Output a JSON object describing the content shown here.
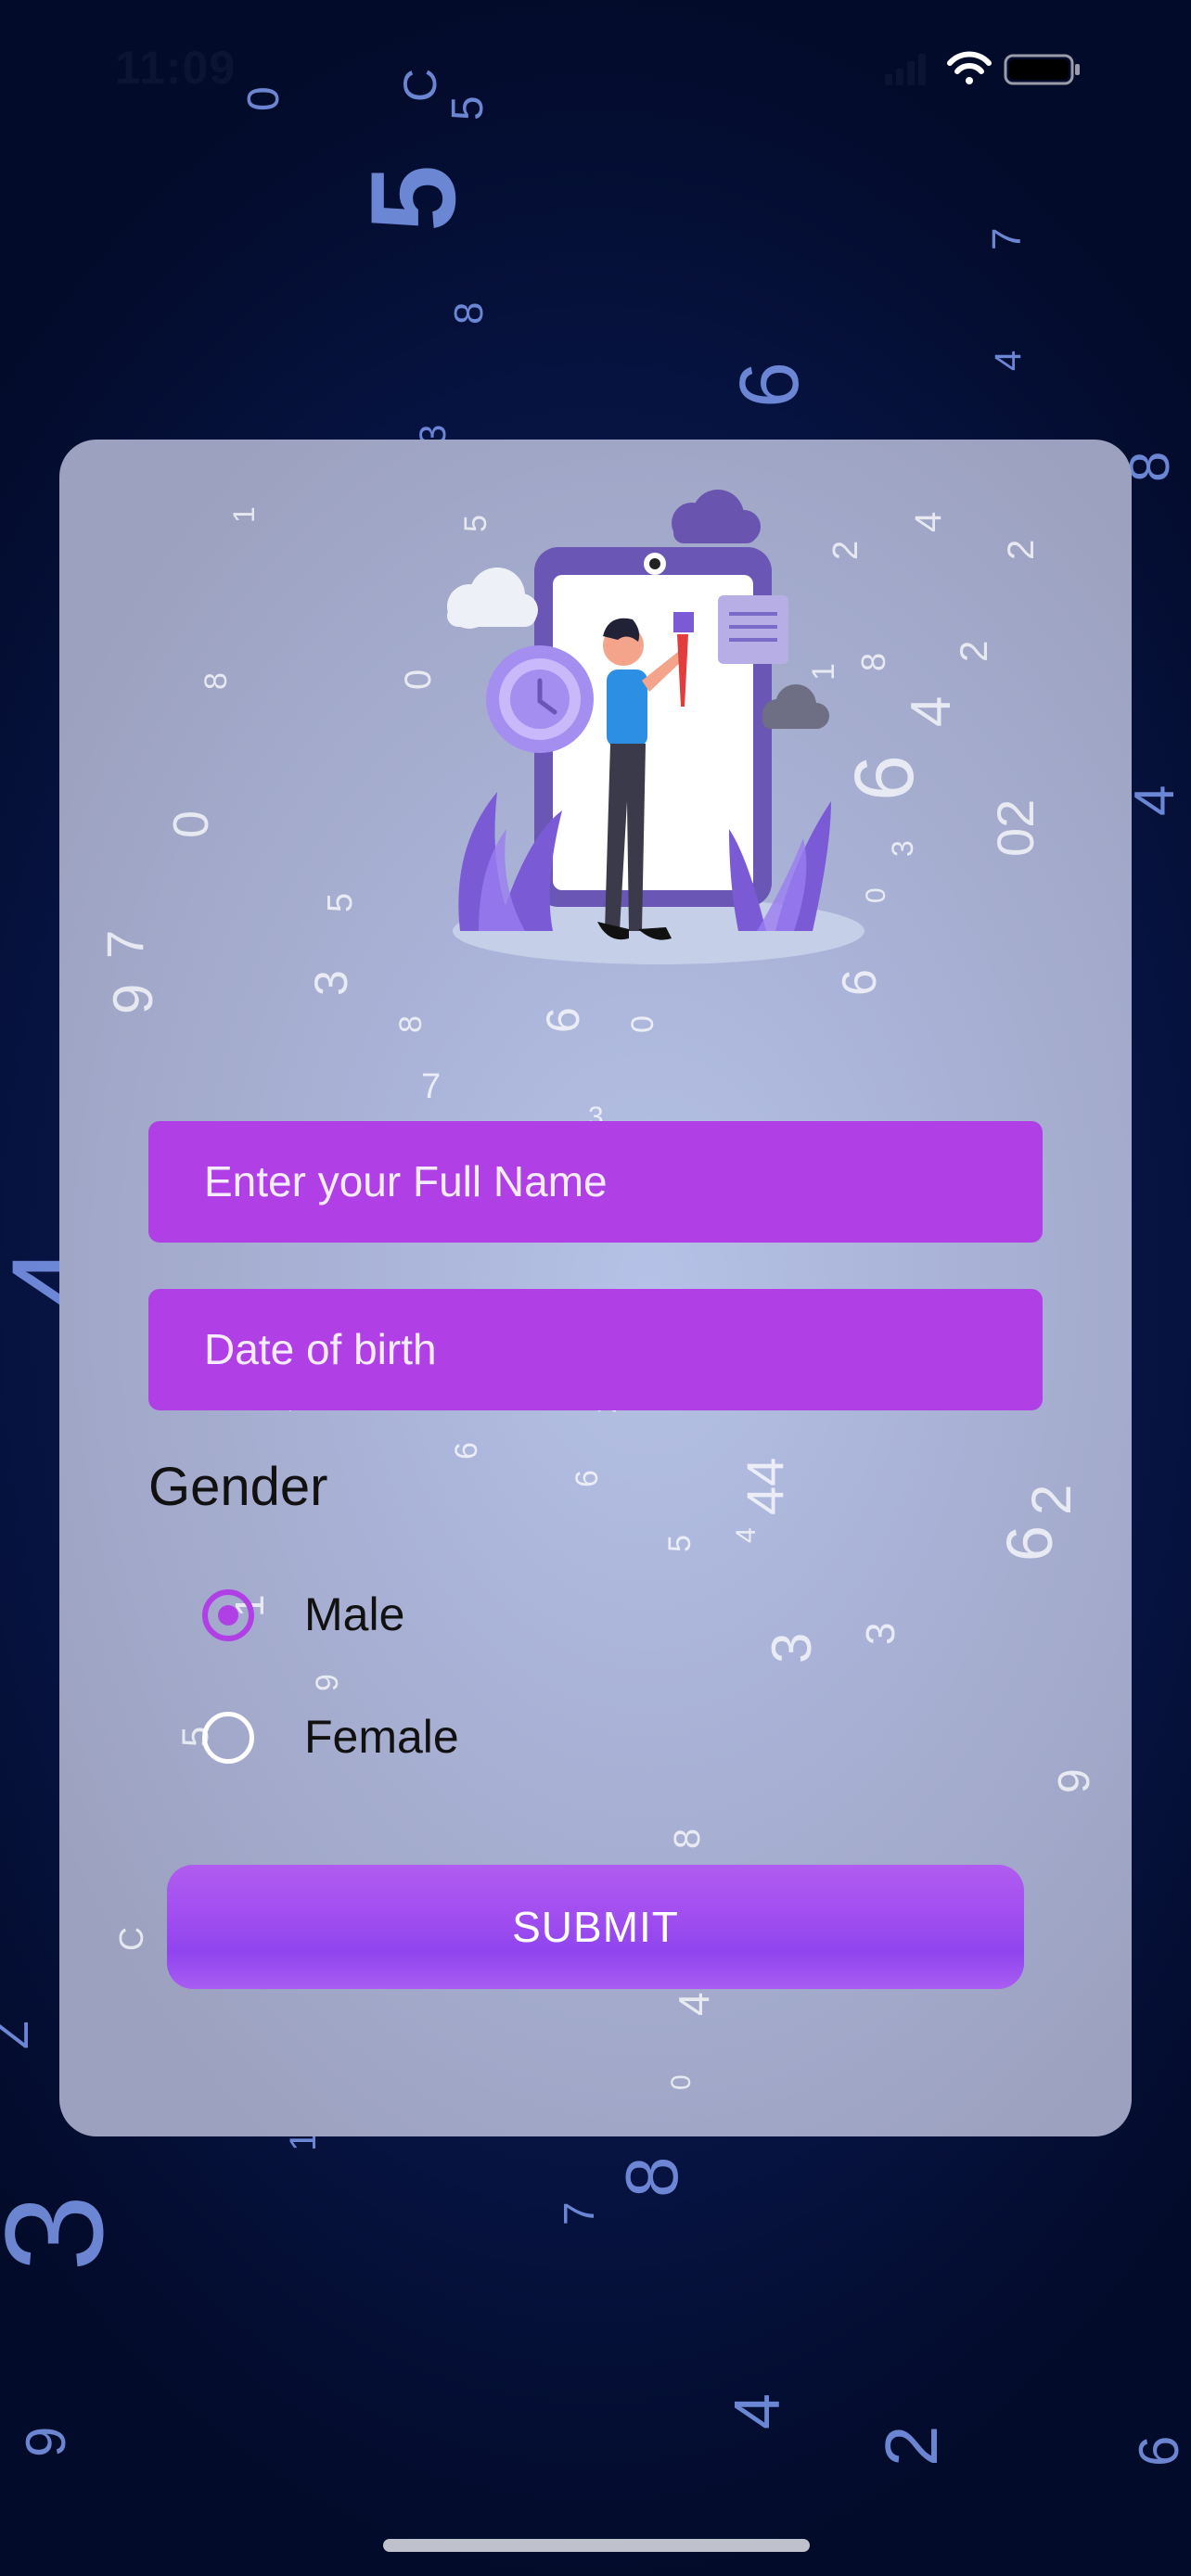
{
  "status_bar": {
    "time": "11:09"
  },
  "form": {
    "full_name_placeholder": "Enter your Full Name",
    "dob_placeholder": "Date of birth",
    "gender_title": "Gender",
    "gender_options": [
      {
        "label": "Male",
        "selected": true
      },
      {
        "label": "Female",
        "selected": false
      }
    ],
    "submit_label": "SUBMIT"
  },
  "colors": {
    "accent": "#b040e6",
    "button": "#9b4df0",
    "background": "#0b1d5c",
    "card": "#a9b2d6"
  },
  "icons": [
    "wifi-icon",
    "battery-icon",
    "signal-icon"
  ]
}
